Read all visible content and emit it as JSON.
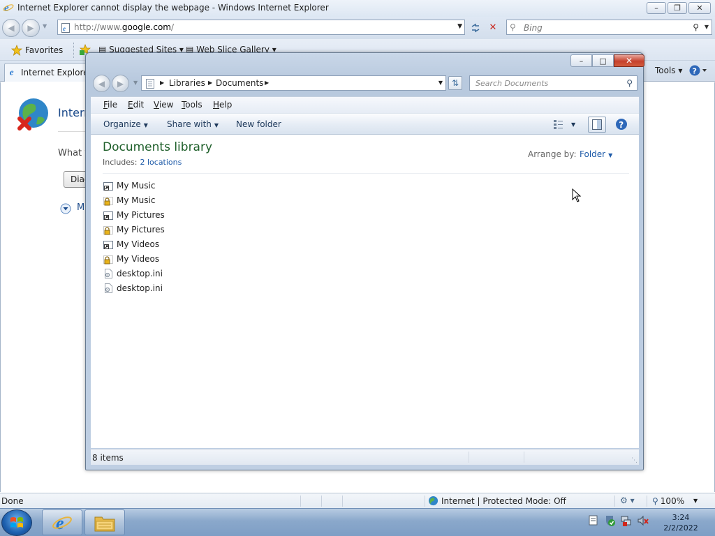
{
  "ie": {
    "title": "Internet Explorer cannot display the webpage - Windows Internet Explorer",
    "url_prefix": "http://www.",
    "url_domain": "google.com",
    "url_suffix": "/",
    "search_placeholder": "Bing",
    "favorites_label": "Favorites",
    "favorites_bar": [
      {
        "label": "Suggested Sites",
        "icon": "page-icon"
      },
      {
        "label": "Web Slice Gallery",
        "icon": "page-icon"
      }
    ],
    "tab_title": "Internet Explorer c",
    "tools_label": "Tools",
    "content": {
      "heading": "Internet",
      "question": "What y",
      "diagnose_button": "Diag",
      "more_link": "M"
    },
    "status": {
      "text": "Done",
      "zone": "Internet | Protected Mode: Off",
      "zoom": "100%"
    }
  },
  "explorer": {
    "breadcrumb": [
      "Libraries",
      "Documents"
    ],
    "search_placeholder": "Search Documents",
    "menu": [
      {
        "label": "File",
        "accel": "F",
        "rest": "ile"
      },
      {
        "label": "Edit",
        "accel": "E",
        "rest": "dit"
      },
      {
        "label": "View",
        "accel": "V",
        "rest": "iew"
      },
      {
        "label": "Tools",
        "accel": "T",
        "rest": "ools"
      },
      {
        "label": "Help",
        "accel": "H",
        "rest": "elp"
      }
    ],
    "commands": {
      "organize": "Organize",
      "share_with": "Share with",
      "new_folder": "New folder"
    },
    "library": {
      "title": "Documents library",
      "includes_label": "Includes:",
      "includes_link": "2 locations",
      "arrange_by_label": "Arrange by:",
      "arrange_by_value": "Folder"
    },
    "items": [
      {
        "name": "My Music",
        "icon": "shortcut-icon"
      },
      {
        "name": "My Music",
        "icon": "lock-icon"
      },
      {
        "name": "My Pictures",
        "icon": "shortcut-icon"
      },
      {
        "name": "My Pictures",
        "icon": "lock-icon"
      },
      {
        "name": "My Videos",
        "icon": "shortcut-icon"
      },
      {
        "name": "My Videos",
        "icon": "lock-icon"
      },
      {
        "name": "desktop.ini",
        "icon": "settings-file-icon"
      },
      {
        "name": "desktop.ini",
        "icon": "settings-file-icon"
      }
    ],
    "status_count": "8 items"
  },
  "taskbar": {
    "apps": [
      {
        "name": "Internet Explorer",
        "icon": "ie-icon"
      },
      {
        "name": "Windows Explorer",
        "icon": "folder-icon"
      }
    ],
    "clock_time": "3:24",
    "clock_date": "2/2/2022"
  },
  "colors": {
    "ie_blue": "#1b4a8a",
    "library_title_green": "#1e5f2a",
    "link_blue": "#1d5aa8",
    "close_red": "#c6412d"
  }
}
